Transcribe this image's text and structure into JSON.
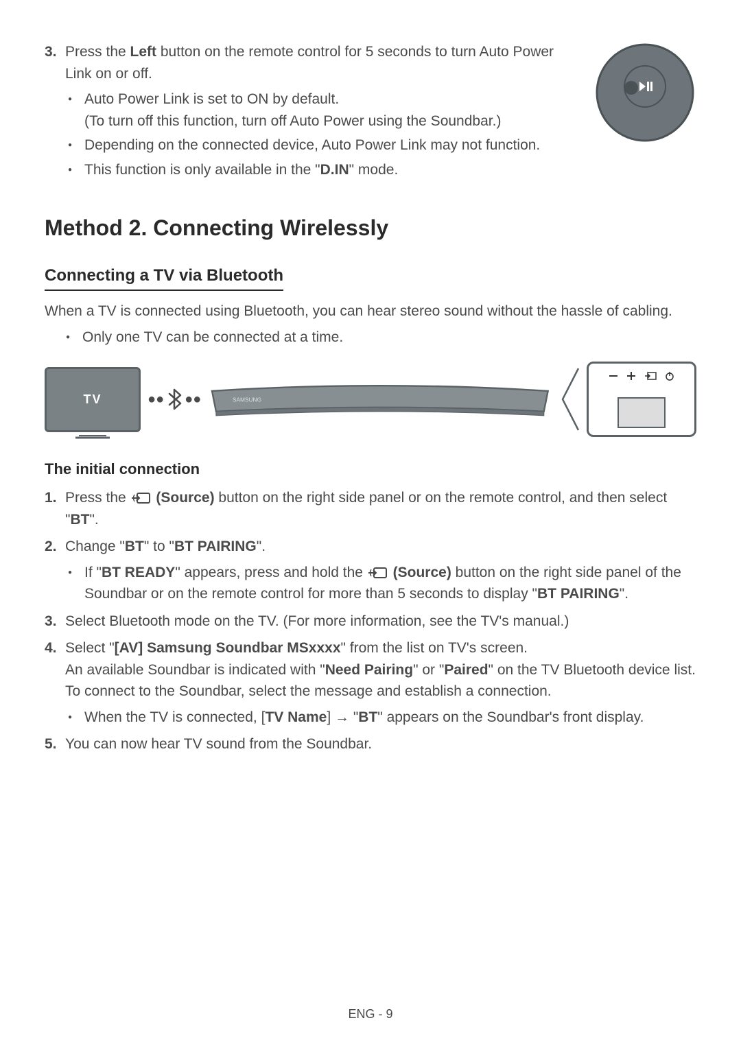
{
  "step3": {
    "num": "3.",
    "text_before": "Press the ",
    "bold1": "Left",
    "text_after": " button on the remote control for 5 seconds to turn Auto Power Link on or off.",
    "sub": [
      {
        "line1": "Auto Power Link is set to ON by default.",
        "line2": "(To turn off this function, turn off Auto Power using the Soundbar.)"
      },
      {
        "line1": "Depending on the connected device, Auto Power Link may not function."
      },
      {
        "text_before": "This function is only available in the \"",
        "bold1": "D.IN",
        "text_after": "\" mode."
      }
    ]
  },
  "h2": "Method 2. Connecting Wirelessly",
  "h3": "Connecting a TV via Bluetooth",
  "intro": "When a TV is connected using Bluetooth, you can hear stereo sound without the hassle of cabling.",
  "intro_bullet": "Only one TV can be connected at a time.",
  "diagram": {
    "tv_label": "TV"
  },
  "h4": "The initial connection",
  "steps": {
    "s1": {
      "num": "1.",
      "t1": "Press the ",
      "bold1": " (Source)",
      "t2": " button on the right side panel or on the remote control, and then select \"",
      "bold2": "BT",
      "t3": "\"."
    },
    "s2": {
      "num": "2.",
      "t1": "Change \"",
      "bold1": "BT",
      "t2": "\" to \"",
      "bold2": "BT PAIRING",
      "t3": "\".",
      "sub": {
        "t1": "If \"",
        "bold1": "BT READY",
        "t2": "\" appears, press and hold the ",
        "bold2": " (Source)",
        "t3": " button on the right side panel of the Soundbar or on the remote control for more than 5 seconds to display \"",
        "bold3": "BT PAIRING",
        "t4": "\"."
      }
    },
    "s3": {
      "num": "3.",
      "t1": "Select Bluetooth mode on the TV. (For more information, see the TV's manual.)"
    },
    "s4": {
      "num": "4.",
      "t1": "Select \"",
      "bold1": "[AV] Samsung Soundbar MSxxxx",
      "t2": "\" from the list on TV's screen.",
      "line2_t1": "An available Soundbar is indicated with \"",
      "line2_bold1": "Need Pairing",
      "line2_t2": "\" or \"",
      "line2_bold2": "Paired",
      "line2_t3": "\" on the TV Bluetooth device list. To connect to the Soundbar, select the message and establish a connection.",
      "sub": {
        "t1": "When the TV is connected, [",
        "bold1": "TV Name",
        "t2": "] → \"",
        "bold2": "BT",
        "t3": "\" appears on the Soundbar's front display."
      }
    },
    "s5": {
      "num": "5.",
      "t1": "You can now hear TV sound from the Soundbar."
    }
  },
  "footer": "ENG - 9"
}
